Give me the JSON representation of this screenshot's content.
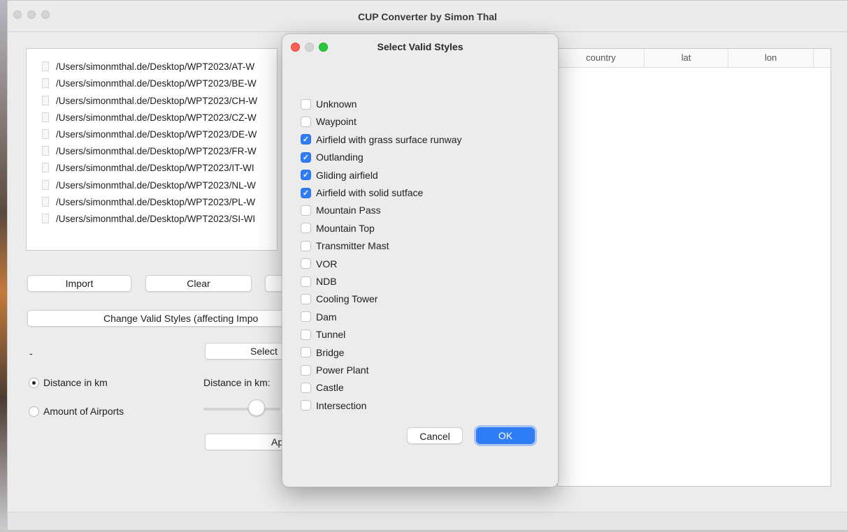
{
  "window": {
    "title": "CUP Converter by Simon Thal"
  },
  "file_list": [
    "/Users/simonmthal.de/Desktop/WPT2023/AT-W",
    "/Users/simonmthal.de/Desktop/WPT2023/BE-W",
    "/Users/simonmthal.de/Desktop/WPT2023/CH-W",
    "/Users/simonmthal.de/Desktop/WPT2023/CZ-W",
    "/Users/simonmthal.de/Desktop/WPT2023/DE-W",
    "/Users/simonmthal.de/Desktop/WPT2023/FR-W",
    "/Users/simonmthal.de/Desktop/WPT2023/IT-WI",
    "/Users/simonmthal.de/Desktop/WPT2023/NL-W",
    "/Users/simonmthal.de/Desktop/WPT2023/PL-W",
    "/Users/simonmthal.de/Desktop/WPT2023/SI-WI"
  ],
  "table": {
    "columns": [
      "country",
      "lat",
      "lon"
    ]
  },
  "buttons": {
    "import": "Import",
    "clear": "Clear",
    "change_styles": "Change Valid Styles (affecting Impo",
    "select": "Select",
    "apply": "Ap"
  },
  "labels": {
    "dash": "-",
    "distance_in_km": "Distance in km:"
  },
  "radios": {
    "distance": "Distance in km",
    "amount": "Amount of Airports"
  },
  "radio_selected": "distance",
  "dialog": {
    "title": "Select Valid Styles",
    "options": [
      {
        "label": "Unknown",
        "checked": false
      },
      {
        "label": "Waypoint",
        "checked": false
      },
      {
        "label": "Airfield with grass surface runway",
        "checked": true
      },
      {
        "label": "Outlanding",
        "checked": true
      },
      {
        "label": "Gliding airfield",
        "checked": true
      },
      {
        "label": "Airfield with solid sutface",
        "checked": true
      },
      {
        "label": "Mountain Pass",
        "checked": false
      },
      {
        "label": "Mountain Top",
        "checked": false
      },
      {
        "label": "Transmitter Mast",
        "checked": false
      },
      {
        "label": "VOR",
        "checked": false
      },
      {
        "label": "NDB",
        "checked": false
      },
      {
        "label": "Cooling Tower",
        "checked": false
      },
      {
        "label": "Dam",
        "checked": false
      },
      {
        "label": "Tunnel",
        "checked": false
      },
      {
        "label": "Bridge",
        "checked": false
      },
      {
        "label": "Power Plant",
        "checked": false
      },
      {
        "label": "Castle",
        "checked": false
      },
      {
        "label": "Intersection",
        "checked": false
      }
    ],
    "cancel": "Cancel",
    "ok": "OK"
  },
  "colors": {
    "accent": "#2e7cf6",
    "close": "#ff5f57",
    "minimize_inactive": "#d4d4d4",
    "zoom": "#28c840"
  }
}
